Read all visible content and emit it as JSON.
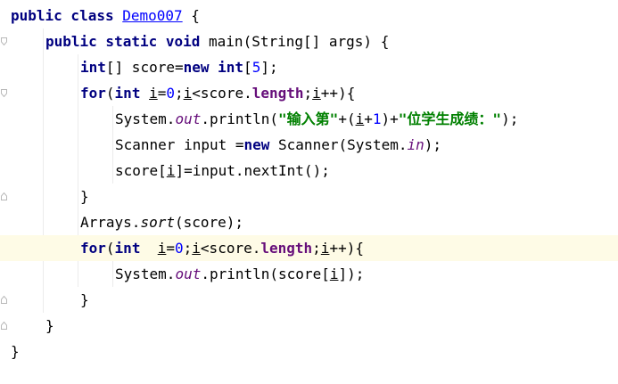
{
  "editor": {
    "lines": [
      {
        "indent": 0,
        "tokens": [
          {
            "t": "public class ",
            "c": "kw"
          },
          {
            "t": "Demo007",
            "c": "link"
          },
          {
            "t": " {",
            "c": ""
          }
        ]
      },
      {
        "indent": 1,
        "tokens": [
          {
            "t": "public static void ",
            "c": "kw"
          },
          {
            "t": "main(String[] args) {",
            "c": ""
          }
        ]
      },
      {
        "indent": 2,
        "tokens": [
          {
            "t": "int",
            "c": "kw"
          },
          {
            "t": "[] score=",
            "c": ""
          },
          {
            "t": "new int",
            "c": "kw"
          },
          {
            "t": "[",
            "c": ""
          },
          {
            "t": "5",
            "c": "num"
          },
          {
            "t": "];",
            "c": ""
          }
        ]
      },
      {
        "indent": 2,
        "tokens": [
          {
            "t": "for",
            "c": "kw"
          },
          {
            "t": "(",
            "c": ""
          },
          {
            "t": "int ",
            "c": "kw"
          },
          {
            "t": "i",
            "c": "ul"
          },
          {
            "t": "=",
            "c": ""
          },
          {
            "t": "0",
            "c": "num"
          },
          {
            "t": ";",
            "c": ""
          },
          {
            "t": "i",
            "c": "ul"
          },
          {
            "t": "<score.",
            "c": ""
          },
          {
            "t": "length",
            "c": "fld"
          },
          {
            "t": ";",
            "c": ""
          },
          {
            "t": "i",
            "c": "ul"
          },
          {
            "t": "++){",
            "c": ""
          }
        ]
      },
      {
        "indent": 3,
        "tokens": [
          {
            "t": "System.",
            "c": ""
          },
          {
            "t": "out",
            "c": "stat"
          },
          {
            "t": ".println(",
            "c": ""
          },
          {
            "t": "\"输入第\"",
            "c": "str"
          },
          {
            "t": "+(",
            "c": ""
          },
          {
            "t": "i",
            "c": "ul"
          },
          {
            "t": "+",
            "c": ""
          },
          {
            "t": "1",
            "c": "num"
          },
          {
            "t": ")+",
            "c": ""
          },
          {
            "t": "\"位学生成绩：\"",
            "c": "str"
          },
          {
            "t": ");",
            "c": ""
          }
        ]
      },
      {
        "indent": 3,
        "tokens": [
          {
            "t": "Scanner input =",
            "c": ""
          },
          {
            "t": "new ",
            "c": "kw"
          },
          {
            "t": "Scanner(System.",
            "c": ""
          },
          {
            "t": "in",
            "c": "stat"
          },
          {
            "t": ");",
            "c": ""
          }
        ]
      },
      {
        "indent": 3,
        "tokens": [
          {
            "t": "score[",
            "c": ""
          },
          {
            "t": "i",
            "c": "ul"
          },
          {
            "t": "]=input.nextInt();",
            "c": ""
          }
        ]
      },
      {
        "indent": 2,
        "tokens": [
          {
            "t": "}",
            "c": ""
          }
        ]
      },
      {
        "indent": 2,
        "tokens": [
          {
            "t": "Arrays.",
            "c": ""
          },
          {
            "t": "sort",
            "c": "staticm"
          },
          {
            "t": "(score);",
            "c": ""
          }
        ]
      },
      {
        "indent": 2,
        "hl": true,
        "tokens": [
          {
            "t": "for",
            "c": "kw"
          },
          {
            "t": "(",
            "c": ""
          },
          {
            "t": "int  ",
            "c": "kw"
          },
          {
            "t": "i",
            "c": "ul"
          },
          {
            "t": "=",
            "c": ""
          },
          {
            "t": "0",
            "c": "num"
          },
          {
            "t": ";",
            "c": ""
          },
          {
            "t": "i",
            "c": "ul"
          },
          {
            "t": "<score.",
            "c": ""
          },
          {
            "t": "length",
            "c": "fld"
          },
          {
            "t": ";",
            "c": ""
          },
          {
            "t": "i",
            "c": "ul"
          },
          {
            "t": "++){",
            "c": ""
          }
        ]
      },
      {
        "indent": 3,
        "tokens": [
          {
            "t": "System.",
            "c": ""
          },
          {
            "t": "out",
            "c": "stat"
          },
          {
            "t": ".println(score[",
            "c": ""
          },
          {
            "t": "i",
            "c": "ul"
          },
          {
            "t": "]);",
            "c": ""
          }
        ]
      },
      {
        "indent": 2,
        "tokens": [
          {
            "t": "}",
            "c": ""
          }
        ]
      },
      {
        "indent": 1,
        "tokens": [
          {
            "t": "}",
            "c": ""
          }
        ]
      },
      {
        "indent": 0,
        "tokens": [
          {
            "t": "}",
            "c": ""
          }
        ]
      }
    ],
    "fold_markers": [
      {
        "line": 1,
        "kind": "open"
      },
      {
        "line": 3,
        "kind": "open"
      },
      {
        "line": 7,
        "kind": "close"
      },
      {
        "line": 9,
        "kind": "open"
      },
      {
        "line": 11,
        "kind": "close"
      },
      {
        "line": 12,
        "kind": "close"
      }
    ]
  }
}
